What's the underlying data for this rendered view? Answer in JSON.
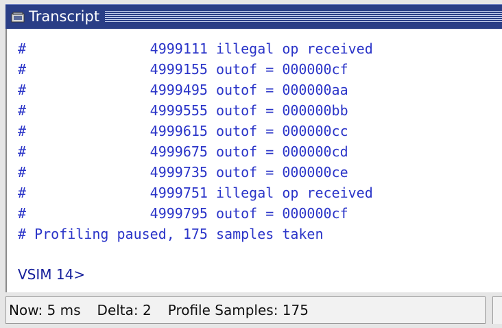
{
  "window": {
    "title": "Transcript",
    "title_icon": "transcript-window-icon"
  },
  "transcript": {
    "lines": [
      "#               4999111 illegal op received",
      "#               4999155 outof = 000000cf",
      "#               4999495 outof = 000000aa",
      "#               4999555 outof = 000000bb",
      "#               4999615 outof = 000000cc",
      "#               4999675 outof = 000000cd",
      "#               4999735 outof = 000000ce",
      "#               4999751 illegal op received",
      "#               4999795 outof = 000000cf",
      "# Profiling paused, 175 samples taken"
    ],
    "prompt": "VSIM 14>"
  },
  "status": {
    "now": "Now: 5 ms",
    "delta": "Delta: 2",
    "profile_samples": "Profile Samples: 175"
  },
  "colors": {
    "titlebar_bg": "#2a3e86",
    "transcript_text": "#2a34c8",
    "prompt_text": "#141e9a"
  }
}
